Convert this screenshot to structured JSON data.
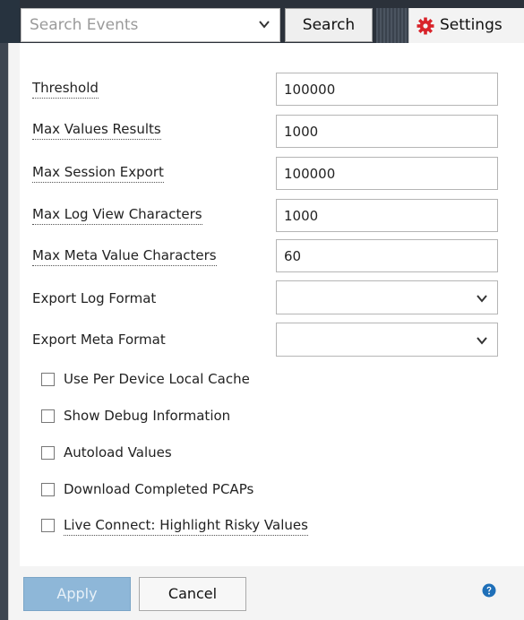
{
  "toolbar": {
    "search_placeholder": "Search Events",
    "search_button": "Search",
    "settings_tab": "Settings"
  },
  "fields": [
    {
      "label": "Threshold",
      "value": "100000"
    },
    {
      "label": "Max Values Results",
      "value": "1000"
    },
    {
      "label": "Max Session Export",
      "value": "100000"
    },
    {
      "label": "Max Log View Characters",
      "value": "1000"
    },
    {
      "label": "Max Meta Value Characters",
      "value": "60"
    }
  ],
  "selects": [
    {
      "label": "Export Log Format",
      "value": ""
    },
    {
      "label": "Export Meta Format",
      "value": ""
    }
  ],
  "checkboxes": [
    {
      "label": "Use Per Device Local Cache",
      "checked": false
    },
    {
      "label": "Show Debug Information",
      "checked": false
    },
    {
      "label": "Autoload Values",
      "checked": false
    },
    {
      "label": "Download Completed PCAPs",
      "checked": false
    },
    {
      "label": "Live Connect: Highlight Risky Values",
      "checked": false
    }
  ],
  "footer": {
    "apply_label": "Apply",
    "cancel_label": "Cancel"
  },
  "colors": {
    "accent_gear": "#d8232a",
    "help_icon": "#1e6fb8",
    "apply_disabled": "#8eb7d8"
  },
  "icons": {
    "dropdown": "chevron-down-icon",
    "settings": "gear-icon",
    "help": "help-circle-icon"
  }
}
